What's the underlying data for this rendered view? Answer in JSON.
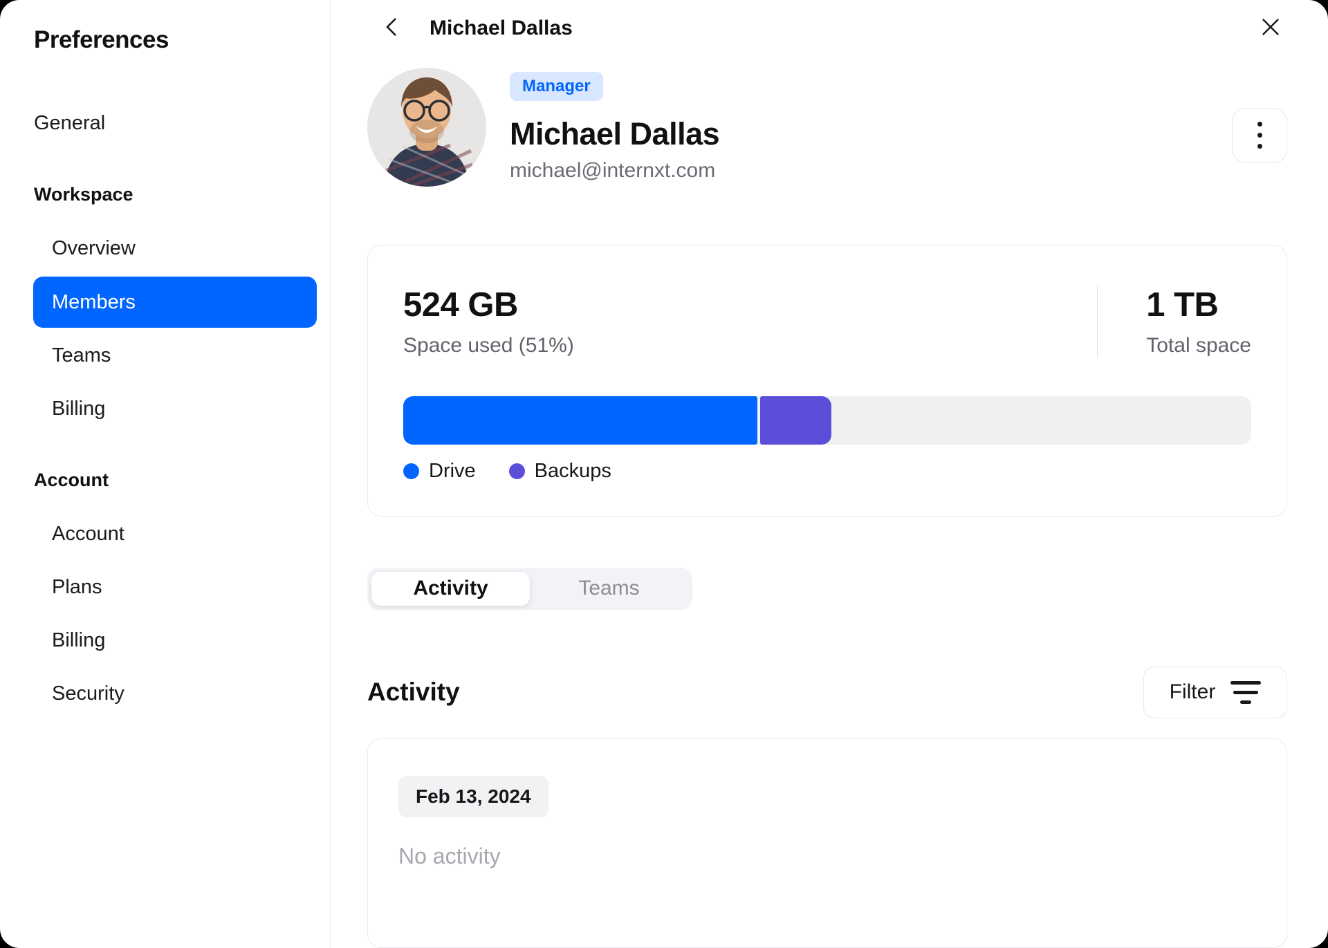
{
  "sidebar": {
    "title": "Preferences",
    "items": [
      {
        "label": "General",
        "type": "item",
        "active": false
      },
      {
        "label": "Workspace",
        "type": "header"
      },
      {
        "label": "Overview",
        "type": "subitem",
        "active": false
      },
      {
        "label": "Members",
        "type": "subitem",
        "active": true
      },
      {
        "label": "Teams",
        "type": "subitem",
        "active": false
      },
      {
        "label": "Billing",
        "type": "subitem",
        "active": false
      },
      {
        "label": "Account",
        "type": "header"
      },
      {
        "label": "Account",
        "type": "subitem",
        "active": false
      },
      {
        "label": "Plans",
        "type": "subitem",
        "active": false
      },
      {
        "label": "Billing",
        "type": "subitem",
        "active": false
      },
      {
        "label": "Security",
        "type": "subitem",
        "active": false
      }
    ]
  },
  "header": {
    "title": "Michael Dallas"
  },
  "profile": {
    "badge": "Manager",
    "name": "Michael Dallas",
    "email": "michael@internxt.com"
  },
  "storage": {
    "used_value": "524 GB",
    "used_label": "Space used (51%)",
    "total_value": "1 TB",
    "total_label": "Total space",
    "bar": {
      "drive_width": "41.8%",
      "backups_width": "8.4%",
      "backups_left": "42.1%"
    },
    "legend": {
      "drive_label": "Drive",
      "backups_label": "Backups"
    },
    "colors": {
      "drive": "#0066ff",
      "backups": "#5b4fd9",
      "track": "#f0f0f3"
    }
  },
  "chart_data": {
    "type": "bar",
    "title": "Space used",
    "categories": [
      "Drive",
      "Backups",
      "Free"
    ],
    "values": [
      41.8,
      8.4,
      49.8
    ],
    "unit": "percent of 1 TB",
    "annotations": [
      "524 GB used (51%)",
      "1 TB total"
    ]
  },
  "tabs": {
    "activity_label": "Activity",
    "teams_label": "Teams"
  },
  "activity": {
    "heading": "Activity",
    "filter_label": "Filter",
    "date_chip": "Feb 13, 2024",
    "empty_text": "No activity"
  },
  "colors": {
    "accent_blue": "#0066ff",
    "badge_bg": "#d9e6ff",
    "active_pill_text": "#ffffff"
  }
}
